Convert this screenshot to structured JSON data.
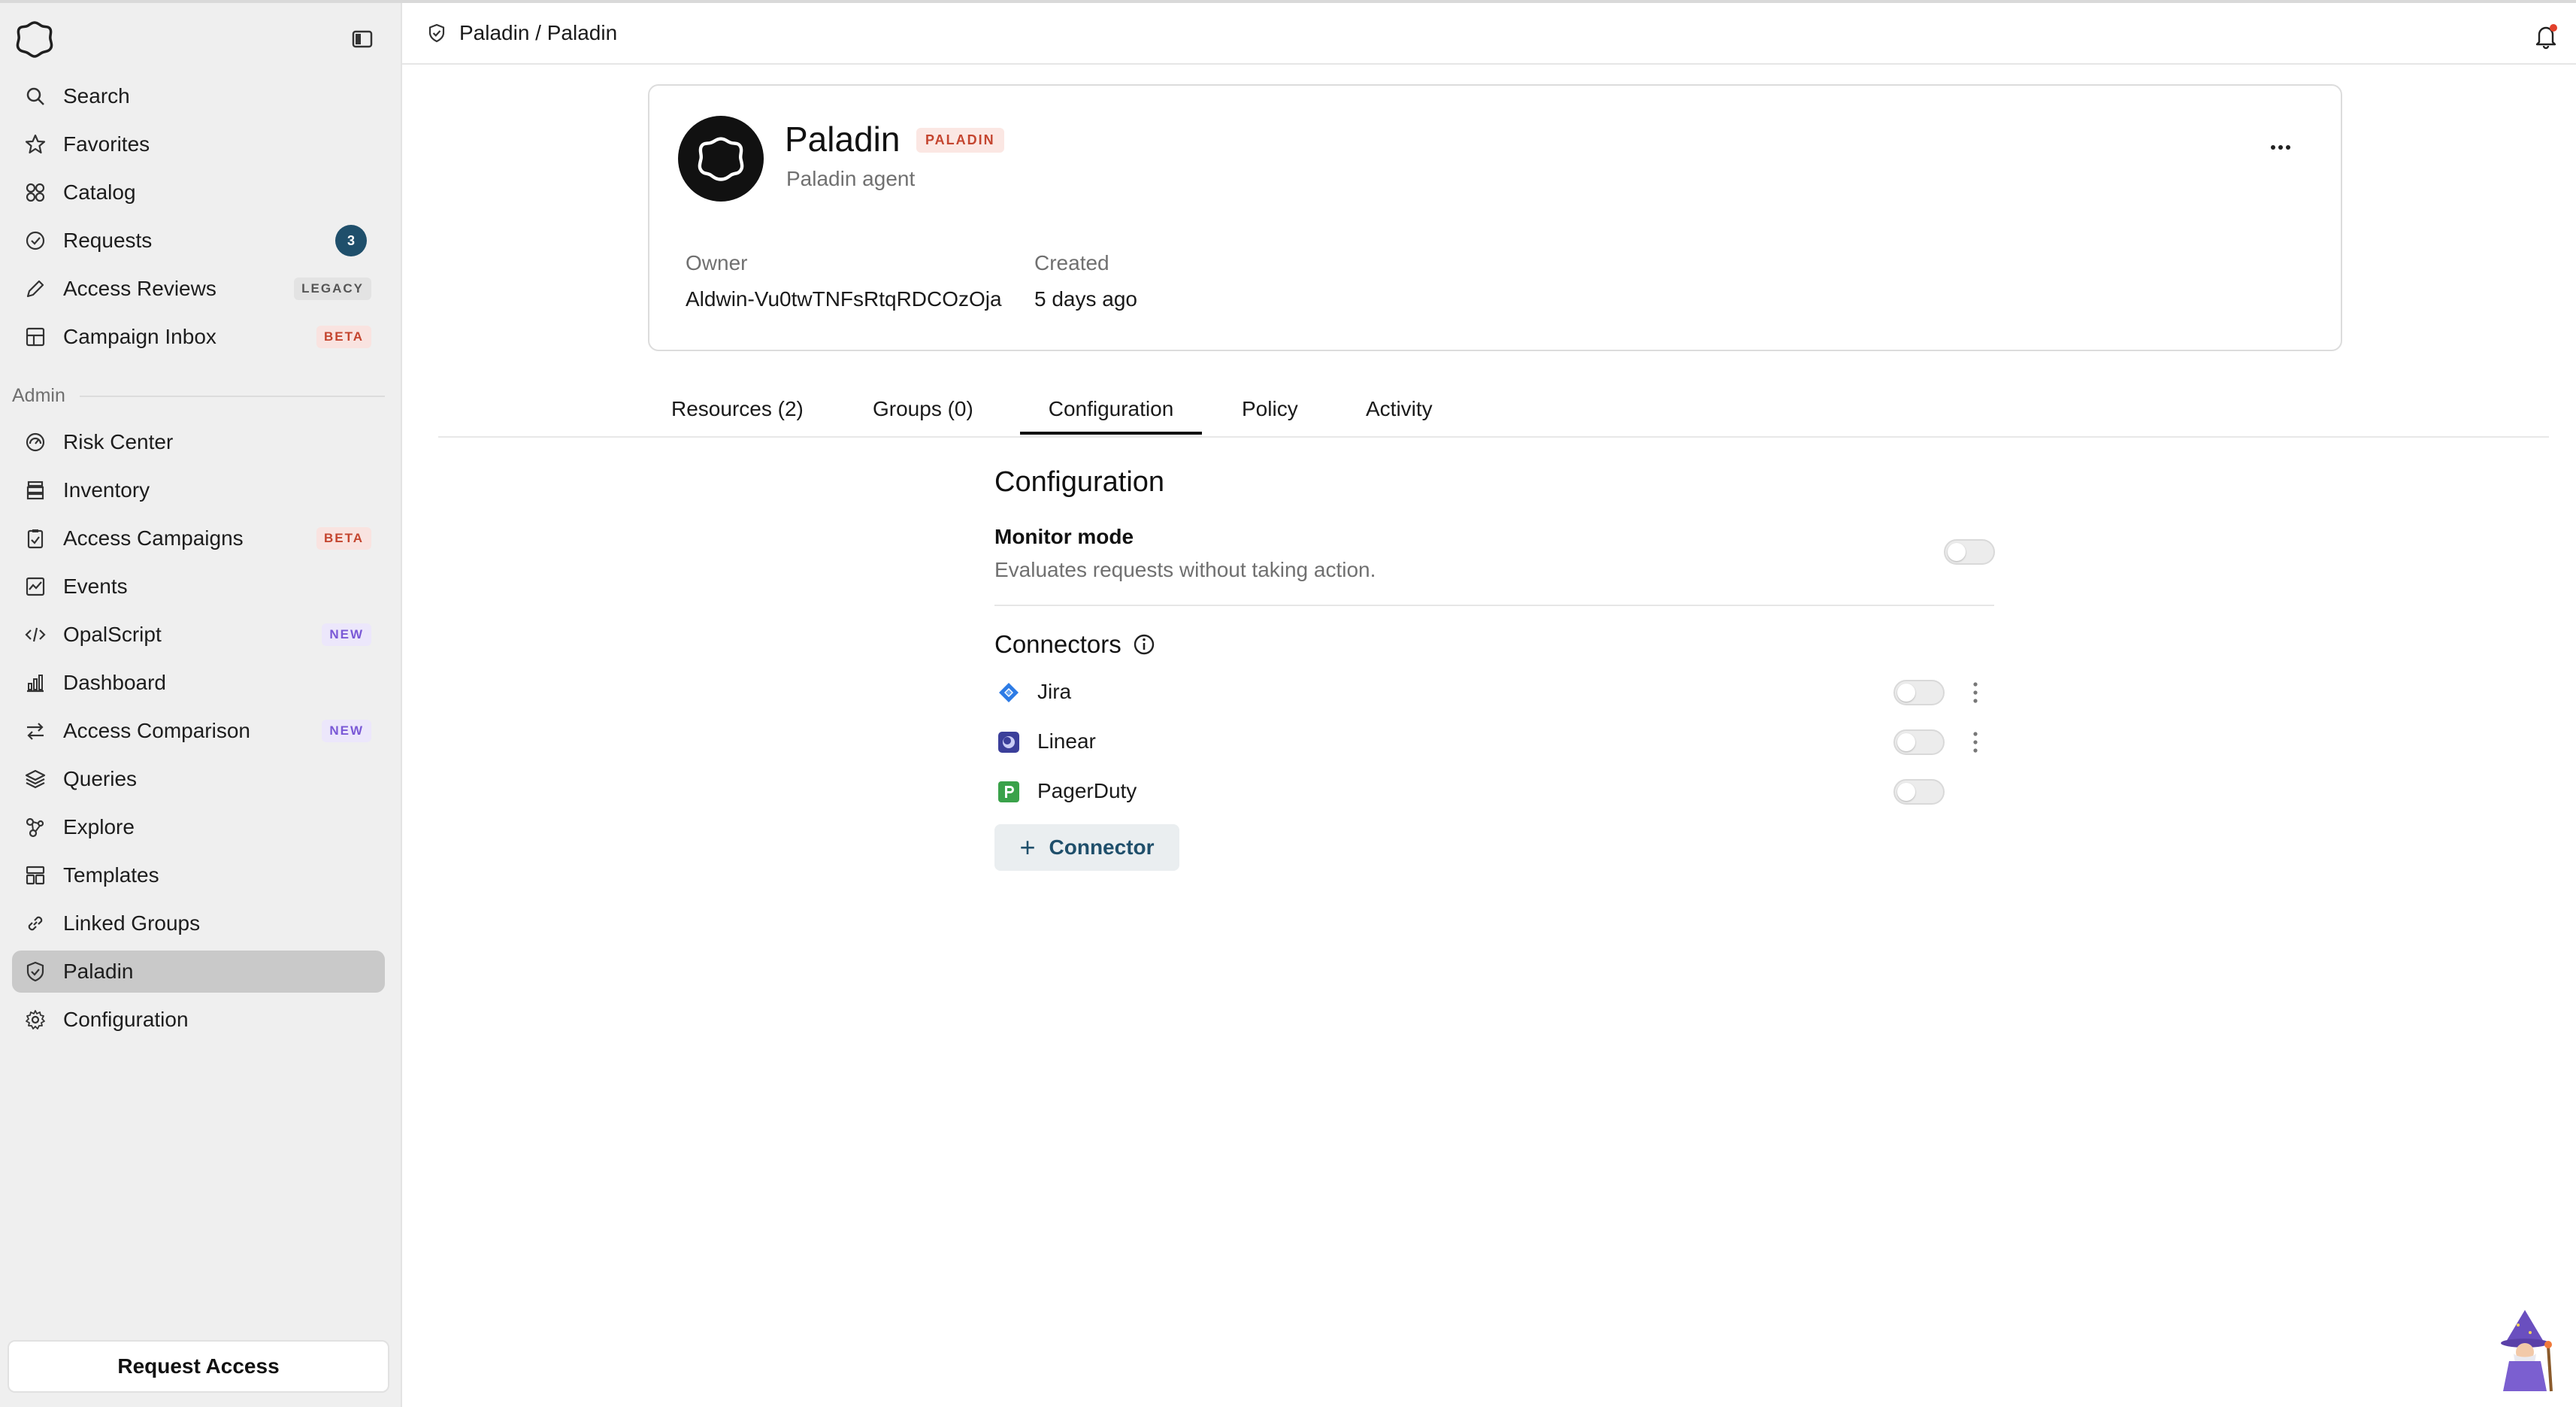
{
  "header": {
    "breadcrumb": "Paladin / Paladin"
  },
  "sidebar": {
    "items_top": [
      {
        "label": "Search",
        "icon": "search-icon"
      },
      {
        "label": "Favorites",
        "icon": "star-icon"
      },
      {
        "label": "Catalog",
        "icon": "grid-icon"
      },
      {
        "label": "Requests",
        "icon": "check-circle-icon",
        "badge": "3"
      },
      {
        "label": "Access Reviews",
        "icon": "pencil-icon",
        "badge": "LEGACY"
      },
      {
        "label": "Campaign Inbox",
        "icon": "layout-icon",
        "badge": "BETA"
      }
    ],
    "section_label": "Admin",
    "items_admin": [
      {
        "label": "Risk Center",
        "icon": "gauge-icon"
      },
      {
        "label": "Inventory",
        "icon": "archive-icon"
      },
      {
        "label": "Access Campaigns",
        "icon": "clipboard-icon",
        "badge": "BETA"
      },
      {
        "label": "Events",
        "icon": "activity-chart-icon"
      },
      {
        "label": "OpalScript",
        "icon": "code-icon",
        "badge": "NEW"
      },
      {
        "label": "Dashboard",
        "icon": "bar-chart-icon"
      },
      {
        "label": "Access Comparison",
        "icon": "arrows-compare-icon",
        "badge": "NEW"
      },
      {
        "label": "Queries",
        "icon": "layers-icon"
      },
      {
        "label": "Explore",
        "icon": "nodes-icon"
      },
      {
        "label": "Templates",
        "icon": "template-icon"
      },
      {
        "label": "Linked Groups",
        "icon": "link-icon"
      },
      {
        "label": "Paladin",
        "icon": "shield-check-icon",
        "active": true
      },
      {
        "label": "Configuration",
        "icon": "gear-icon"
      }
    ],
    "request_access": "Request Access"
  },
  "card": {
    "name": "Paladin",
    "tag": "PALADIN",
    "subtitle": "Paladin agent",
    "owner_label": "Owner",
    "owner_value": "Aldwin-Vu0twTNFsRtqRDCOzOja",
    "created_label": "Created",
    "created_value": "5 days ago"
  },
  "tabs": [
    {
      "label": "Resources (2)",
      "active": false
    },
    {
      "label": "Groups (0)",
      "active": false
    },
    {
      "label": "Configuration",
      "active": true
    },
    {
      "label": "Policy",
      "active": false
    },
    {
      "label": "Activity",
      "active": false
    }
  ],
  "configuration": {
    "title": "Configuration",
    "monitor_mode_title": "Monitor mode",
    "monitor_mode_desc": "Evaluates requests without taking action.",
    "monitor_mode_enabled": false,
    "connectors_title": "Connectors",
    "connectors": [
      {
        "name": "Jira",
        "icon": "jira-icon",
        "enabled": false,
        "has_menu": true
      },
      {
        "name": "Linear",
        "icon": "linear-icon",
        "enabled": false,
        "has_menu": true
      },
      {
        "name": "PagerDuty",
        "icon": "pagerduty-icon",
        "enabled": false,
        "has_menu": false
      }
    ],
    "add_connector_label": "Connector"
  },
  "colors": {
    "accent": "#1f4f6b",
    "beta_text": "#c4452f",
    "new_text": "#7a59d6",
    "sidebar_bg": "#efefef",
    "active_item_bg": "#c9c9c9"
  }
}
